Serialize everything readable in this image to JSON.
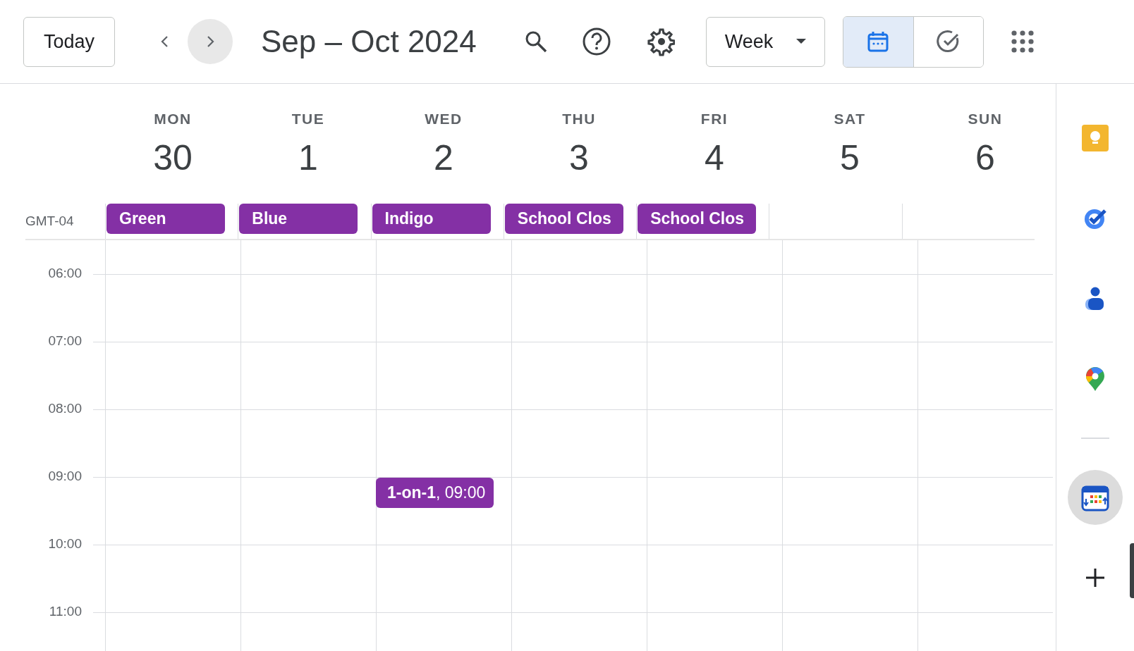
{
  "toolbar": {
    "today": "Today",
    "next_button": {
      "hovered": true
    },
    "title": "Sep – Oct 2024",
    "view": "Week",
    "modes": [
      {
        "kind": "calendar",
        "selected": true
      },
      {
        "kind": "tasks",
        "selected": false
      }
    ]
  },
  "timezone": "GMT-04",
  "days": [
    {
      "dow": "MON",
      "date": "30",
      "all_day": {
        "title": "Green",
        "color": "#8430a5"
      }
    },
    {
      "dow": "TUE",
      "date": "1",
      "all_day": {
        "title": "Blue",
        "color": "#8430a5"
      }
    },
    {
      "dow": "WED",
      "date": "2",
      "all_day": {
        "title": "Indigo",
        "color": "#8430a5"
      }
    },
    {
      "dow": "THU",
      "date": "3",
      "all_day": {
        "title": "School Clos",
        "color": "#8430a5"
      }
    },
    {
      "dow": "FRI",
      "date": "4",
      "all_day": {
        "title": "School Clos",
        "color": "#8430a5"
      }
    },
    {
      "dow": "SAT",
      "date": "5"
    },
    {
      "dow": "SUN",
      "date": "6"
    }
  ],
  "hours": [
    "06:00",
    "07:00",
    "08:00",
    "09:00",
    "10:00",
    "11:00"
  ],
  "events": [
    {
      "title": "**1-on-1**, 09:00",
      "color": "#8430a5"
    }
  ],
  "side_apps": [
    {
      "kind": "keep",
      "selected": false
    },
    {
      "kind": "tasks",
      "selected": false
    },
    {
      "kind": "contacts",
      "selected": false
    },
    {
      "kind": "maps",
      "selected": false
    },
    {
      "kind": "divider"
    },
    {
      "kind": "addon",
      "selected": true
    },
    {
      "kind": "add",
      "selected": false
    }
  ]
}
